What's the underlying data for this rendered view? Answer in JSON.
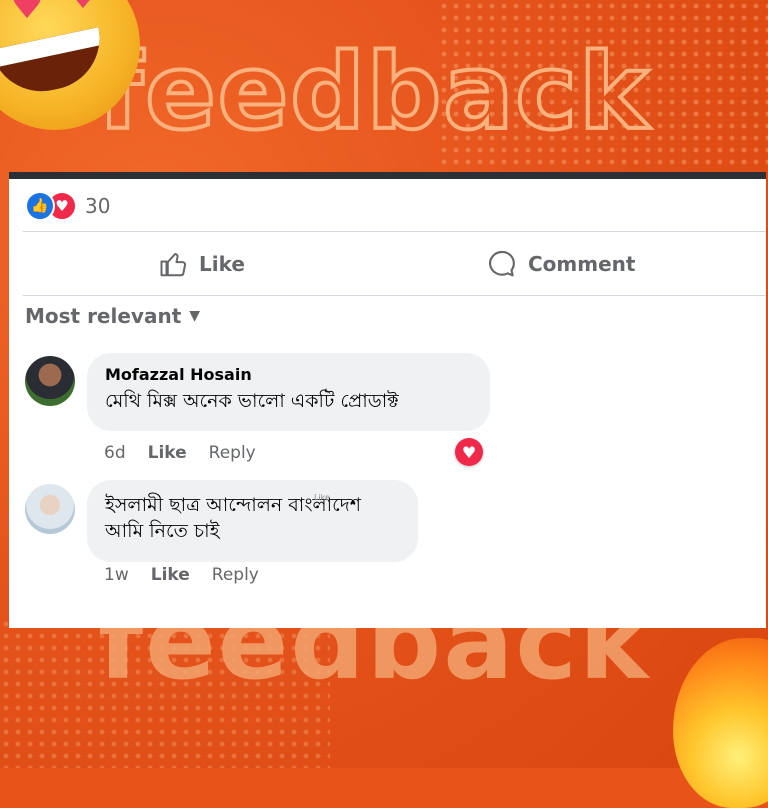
{
  "banner": {
    "headline": "feedback"
  },
  "post": {
    "reaction_count": "30",
    "reaction_icons": [
      "like-icon",
      "love-icon"
    ],
    "actions": {
      "like_label": "Like",
      "comment_label": "Comment"
    },
    "sort_label": "Most relevant"
  },
  "comments": [
    {
      "author": "Mofazzal Hosain",
      "text": "মেথি মিক্স অনেক ভালো একটি প্রোডাক্ট",
      "time": "6d",
      "like_label": "Like",
      "reply_label": "Reply",
      "reaction": "love-icon"
    },
    {
      "author": "",
      "text_line1": "ইসলামী ছাত্র আন্দোলন বাংলাদেশ",
      "text_line2": "আমি নিতে চাই",
      "overlay_like": "Like",
      "time": "1w",
      "like_label": "Like",
      "reply_label": "Reply"
    }
  ],
  "colors": {
    "accent": "#1b74e4",
    "love": "#f0284a",
    "background": "#e8531a"
  }
}
